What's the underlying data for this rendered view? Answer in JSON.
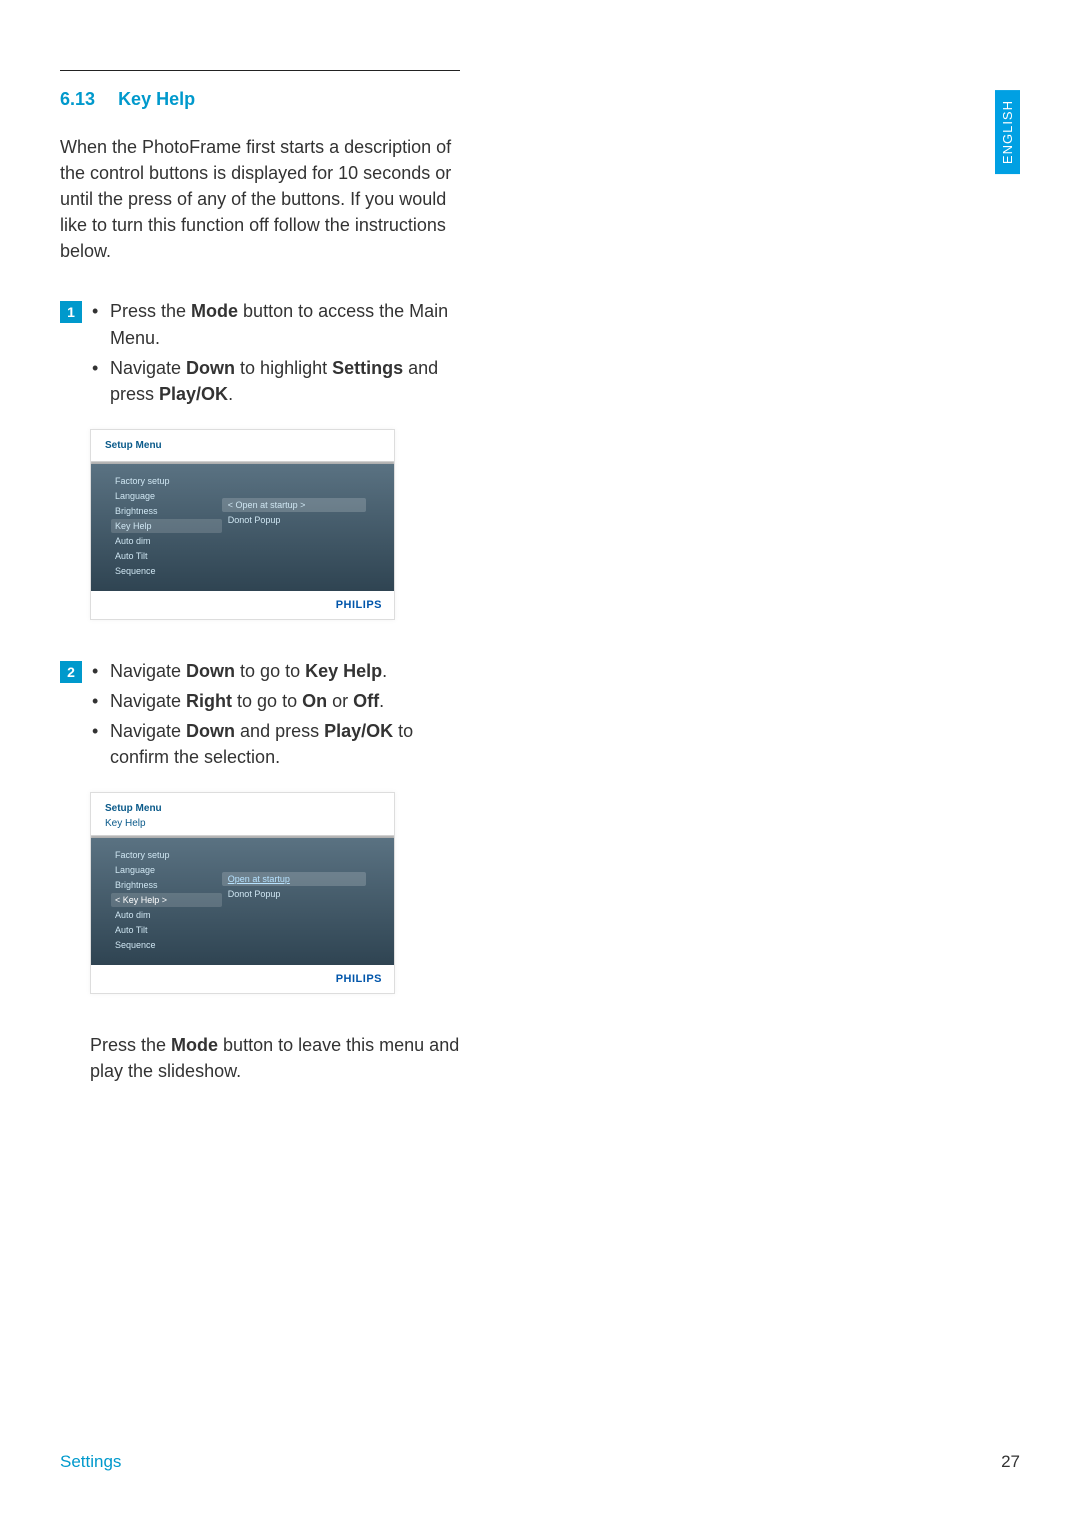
{
  "heading": {
    "number": "6.13",
    "title": "Key Help"
  },
  "intro": "When the PhotoFrame first starts a description of the control buttons is displayed for 10 seconds or until the press of any of the buttons. If you would like to turn this function off follow the instructions below.",
  "steps": {
    "step1": {
      "num": "1",
      "bullets": [
        {
          "pre": "Press the ",
          "b1": "Mode",
          "post": " button to access the Main Menu."
        },
        {
          "pre": "Navigate ",
          "b1": "Down",
          "mid": " to highlight ",
          "b2": "Settings",
          "mid2": " and press ",
          "b3": "Play/OK",
          "post": "."
        }
      ]
    },
    "step2": {
      "num": "2",
      "bullets": [
        {
          "pre": "Navigate ",
          "b1": "Down",
          "mid": " to go to ",
          "b2": "Key Help",
          "post": "."
        },
        {
          "pre": "Navigate ",
          "b1": "Right",
          "mid": " to go to ",
          "b2": "On",
          "mid2": " or ",
          "b3": "Off",
          "post": "."
        },
        {
          "pre": "Navigate ",
          "b1": "Down",
          "mid": " and press ",
          "b2": "Play/OK",
          "post": " to confirm the selection."
        }
      ]
    }
  },
  "screenshot1": {
    "title": "Setup Menu",
    "menu": [
      "Factory setup",
      "Language",
      "Brightness",
      "Key Help",
      "Auto dim",
      "Auto Tilt",
      "Sequence"
    ],
    "selectedIndex": 3,
    "panel": [
      "< Open at startup >",
      "Donot Popup"
    ],
    "panelSelectedIndex": 0,
    "brand": "PHILIPS"
  },
  "screenshot2": {
    "title": "Setup Menu",
    "subtitle": "Key Help",
    "menu": [
      "Factory setup",
      "Language",
      "Brightness",
      "< Key Help >",
      "Auto dim",
      "Auto Tilt",
      "Sequence"
    ],
    "selectedIndex": 3,
    "panel": [
      "Open at startup",
      "Donot Popup"
    ],
    "panelHighlightIndex": 0,
    "brand": "PHILIPS"
  },
  "closing": {
    "pre": "Press the ",
    "b1": "Mode",
    "post": " button to leave this menu and play the slideshow."
  },
  "langTab": "ENGLISH",
  "footer": {
    "section": "Settings",
    "page": "27"
  }
}
